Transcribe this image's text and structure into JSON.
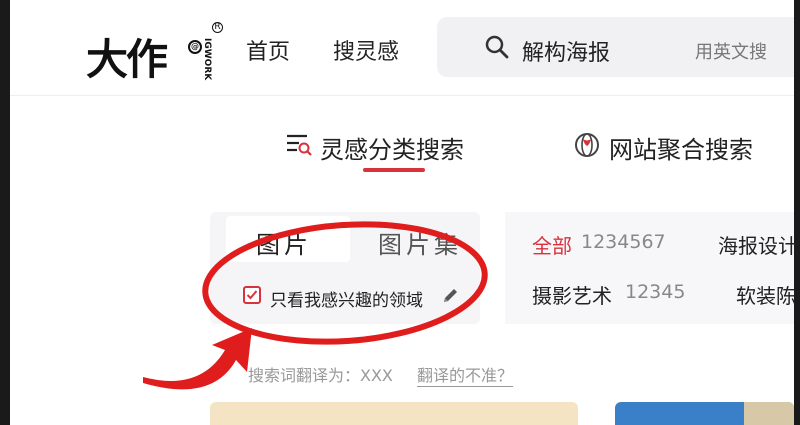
{
  "logo": {
    "main": "大作",
    "vertical": "IGWORK",
    "badge": "@",
    "reg": "R"
  },
  "nav": {
    "home": "首页",
    "inspiration": "搜灵感"
  },
  "search": {
    "query": "解构海报",
    "hint": "用英文搜"
  },
  "category_tabs": [
    {
      "label": "灵感分类搜索",
      "active": true
    },
    {
      "label": "网站聚合搜索",
      "active": false
    }
  ],
  "segments": [
    {
      "label": "图片",
      "active": true
    },
    {
      "label": "图片集",
      "active": false
    }
  ],
  "filter": {
    "checkbox_label": "只看我感兴趣的领域",
    "checked": true
  },
  "categories": [
    {
      "name": "全部",
      "count": "1234567",
      "active": true
    },
    {
      "name": "海报设计",
      "count": ""
    },
    {
      "name": "摄影艺术",
      "count": "12345"
    },
    {
      "name": "软装陈",
      "count": ""
    }
  ],
  "translate": {
    "prefix": "搜索词翻译为：XXX",
    "link": "翻译的不准？"
  },
  "colors": {
    "accent": "#d8323c",
    "annotation": "#e01d1d"
  }
}
